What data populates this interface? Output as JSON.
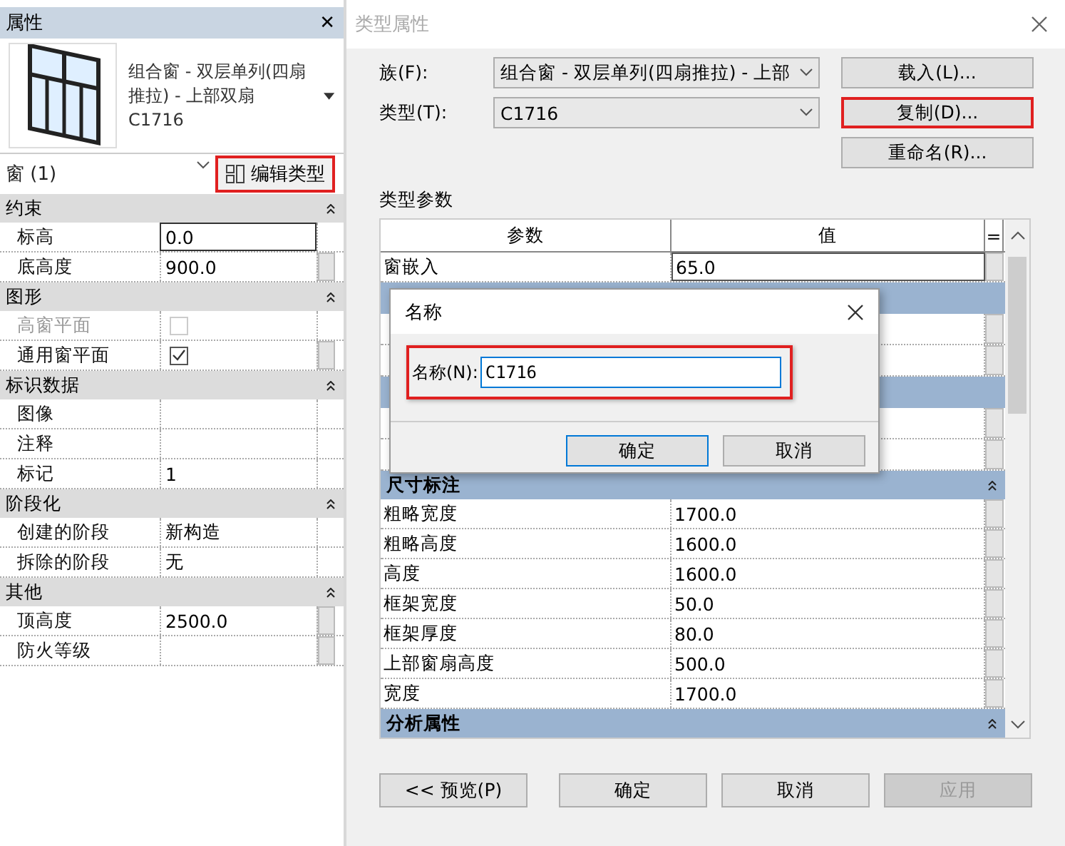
{
  "properties_panel": {
    "title": "属性",
    "close": "✕",
    "type_name": "组合窗 - 双层单列(四扇推拉) - 上部双扇 C1716",
    "instance_filter": "窗 (1)",
    "edit_type_button": {
      "label": "编辑类型",
      "highlighted": true
    },
    "groups": [
      {
        "name": "约束",
        "rows": [
          {
            "kind": "text",
            "label": "标高",
            "value": "0.0",
            "disabled": false,
            "editing": true,
            "linked": false
          },
          {
            "kind": "text",
            "label": "底高度",
            "value": "900.0",
            "disabled": false,
            "editing": false,
            "linked": true
          }
        ]
      },
      {
        "name": "图形",
        "rows": [
          {
            "kind": "checkbox",
            "label": "高窗平面",
            "checked": false,
            "disabled": true,
            "editing": false,
            "linked": false
          },
          {
            "kind": "checkbox",
            "label": "通用窗平面",
            "checked": true,
            "disabled": false,
            "editing": false,
            "linked": true
          }
        ]
      },
      {
        "name": "标识数据",
        "rows": [
          {
            "kind": "text",
            "label": "图像",
            "value": "",
            "disabled": false,
            "editing": false,
            "linked": false
          },
          {
            "kind": "text",
            "label": "注释",
            "value": "",
            "disabled": false,
            "editing": false,
            "linked": false
          },
          {
            "kind": "text",
            "label": "标记",
            "value": "1",
            "disabled": false,
            "editing": false,
            "linked": false
          }
        ]
      },
      {
        "name": "阶段化",
        "rows": [
          {
            "kind": "text",
            "label": "创建的阶段",
            "value": "新构造",
            "disabled": false,
            "editing": false,
            "linked": false
          },
          {
            "kind": "text",
            "label": "拆除的阶段",
            "value": "无",
            "disabled": false,
            "editing": false,
            "linked": false
          }
        ]
      },
      {
        "name": "其他",
        "rows": [
          {
            "kind": "text",
            "label": "顶高度",
            "value": "2500.0",
            "disabled": false,
            "editing": false,
            "linked": true
          },
          {
            "kind": "text",
            "label": "防火等级",
            "value": "",
            "disabled": false,
            "editing": false,
            "linked": true
          }
        ]
      }
    ]
  },
  "type_dialog": {
    "title": "类型属性",
    "family_label": "族(F):",
    "family_value": "组合窗 - 双层单列(四扇推拉) - 上部",
    "type_label": "类型(T):",
    "type_value": "C1716",
    "side_buttons": [
      {
        "label": "载入(L)...",
        "highlighted": false
      },
      {
        "label": "复制(D)...",
        "highlighted": true
      },
      {
        "label": "重命名(R)...",
        "highlighted": false
      }
    ],
    "params_label": "类型参数",
    "columns": [
      "参数",
      "值",
      "="
    ],
    "top_rows": [
      {
        "label": "窗嵌入",
        "value": "65.0"
      }
    ],
    "groups": [
      {
        "name": "尺寸标注",
        "rows": [
          {
            "label": "粗略宽度",
            "value": "1700.0"
          },
          {
            "label": "粗略高度",
            "value": "1600.0"
          },
          {
            "label": "高度",
            "value": "1600.0"
          },
          {
            "label": "框架宽度",
            "value": "50.0"
          },
          {
            "label": "框架厚度",
            "value": "80.0"
          },
          {
            "label": "上部窗扇高度",
            "value": "500.0"
          },
          {
            "label": "宽度",
            "value": "1700.0"
          }
        ]
      },
      {
        "name": "分析属性"
      }
    ],
    "bottom_buttons": [
      {
        "label": "<< 预览(P)",
        "disabled": false
      },
      {
        "label": "确定",
        "disabled": false
      },
      {
        "label": "取消",
        "disabled": false
      },
      {
        "label": "应用",
        "disabled": true
      }
    ]
  },
  "name_dialog": {
    "title": "名称",
    "field_label": "名称(N):",
    "value": "C1716",
    "highlighted": true,
    "buttons": [
      {
        "label": "确定",
        "default": true
      },
      {
        "label": "取消",
        "default": false
      }
    ]
  }
}
